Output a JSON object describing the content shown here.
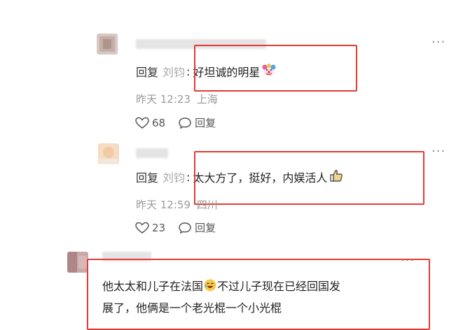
{
  "more_label": "···",
  "replies": [
    {
      "reply_prefix": "回复",
      "mention": "刘钧",
      "separator": ":",
      "text": "好坦诚的明星",
      "emoji_icon": "clown-face",
      "time": "昨天 12:23",
      "location": "上海",
      "likes": "68",
      "reply_label": "回复"
    },
    {
      "reply_prefix": "回复",
      "mention": "刘钧",
      "separator": ":",
      "text": "太大方了，挺好，内娱活人",
      "emoji_icon": "thumbs-up",
      "time": "昨天 12:59",
      "location": "四川",
      "likes": "23",
      "reply_label": "回复"
    }
  ],
  "comment": {
    "text_part1": "他太太和儿子在法国",
    "emoji_icon": "laughing-face",
    "text_part2": "不过儿子现在已经回国发",
    "text_line2": "展了，他俩是一个老光棍一个小光棍"
  },
  "colors": {
    "highlight_border": "#e53935",
    "meta_text": "#9a9a9a",
    "mention_text": "#a9a9a9"
  }
}
